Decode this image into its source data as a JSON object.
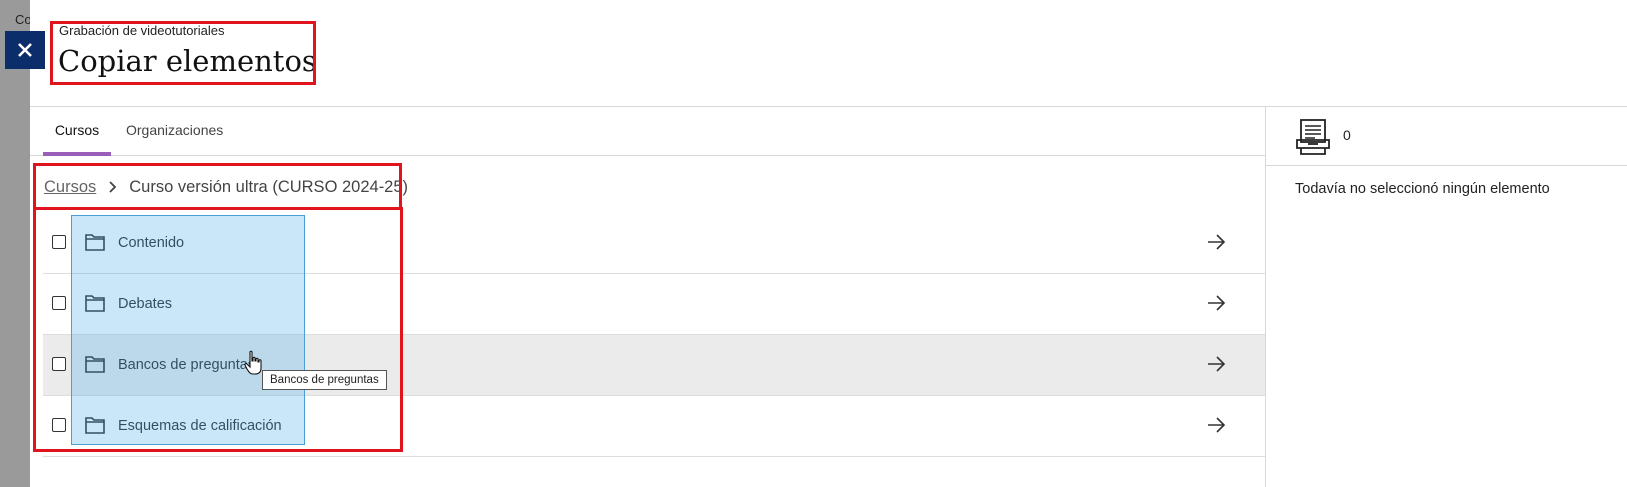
{
  "background": {
    "partial_text": "Co"
  },
  "header": {
    "subtitle": "Grabación de videotutoriales",
    "title": "Copiar elementos"
  },
  "tabs": [
    {
      "label": "Cursos",
      "selected": true
    },
    {
      "label": "Organizaciones",
      "selected": false
    }
  ],
  "breadcrumb": {
    "link": "Cursos",
    "current": "Curso versión ultra (CURSO 2024-25)"
  },
  "items": [
    {
      "label": "Contenido",
      "icon": "folder-icon",
      "checked": false
    },
    {
      "label": "Debates",
      "icon": "folder-icon",
      "checked": false
    },
    {
      "label": "Bancos de preguntas",
      "icon": "folder-icon",
      "checked": false
    },
    {
      "label": "Esquemas de calificación",
      "icon": "folder-icon",
      "checked": false
    }
  ],
  "tooltip": "Bancos de preguntas",
  "selection_panel": {
    "count": "0",
    "empty_message": "Todavía no seleccionó ningún elemento"
  },
  "colors": {
    "close_button": "#0b2e6b",
    "annotation": "#e0141c",
    "tab_indicator": "#9a5fb8",
    "selection_overlay": "#5ab4f0"
  }
}
